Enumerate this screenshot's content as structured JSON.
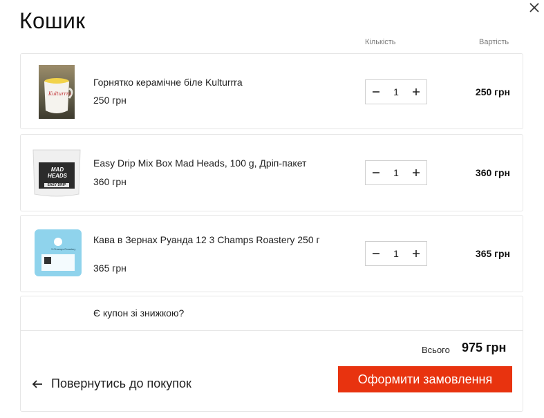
{
  "header": {
    "title": "Кошик",
    "close_icon": "close-icon"
  },
  "columns": {
    "quantity": "Кількість",
    "cost": "Вартість"
  },
  "items": [
    {
      "name": "Горнятко керамічне біле Kulturrra",
      "price": "250 грн",
      "quantity": "1",
      "total": "250 грн",
      "thumb_text": "Kulturrra"
    },
    {
      "name": "Easy Drip Mix Box Mad Heads, 100 g, Дріп-пакет",
      "price": "360 грн",
      "quantity": "1",
      "total": "360 грн",
      "thumb_text": "MAD HEADS",
      "thumb_sub": "EASY DRIP"
    },
    {
      "name": "Кава в Зернах Руанда 12 3 Champs Roastery 250 г",
      "price": "365 грн",
      "quantity": "1",
      "total": "365 грн",
      "thumb_text": "3 Champs Roastery"
    }
  ],
  "footer": {
    "coupon": "Є купон зі знижкою?",
    "total_label": "Всього",
    "total_value": "975 грн",
    "back_label": "Повернутись до покупок",
    "checkout_label": "Оформити замовлення"
  },
  "colors": {
    "accent": "#e8330f",
    "border": "#e6e6e6"
  }
}
